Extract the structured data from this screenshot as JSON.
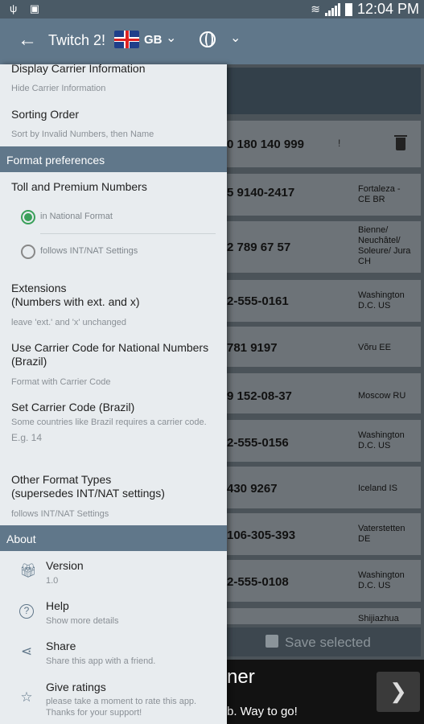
{
  "status": {
    "time": "12:04 PM"
  },
  "appbar": {
    "title": "Twitch 2!",
    "country": "GB"
  },
  "list": {
    "rows": [
      {
        "num": "0 180 140 999",
        "loc": ""
      },
      {
        "num": "5 9140-2417",
        "loc": "Fortaleza - CE BR"
      },
      {
        "num": "2 789 67 57",
        "loc": "Bienne/ Neuchâtel/ Soleure/ Jura CH"
      },
      {
        "num": "2-555-0161",
        "loc": "Washington D.C. US"
      },
      {
        "num": "781 9197",
        "loc": "Võru EE"
      },
      {
        "num": "9 152-08-37",
        "loc": "Moscow RU"
      },
      {
        "num": "2-555-0156",
        "loc": "Washington D.C. US"
      },
      {
        "num": "430 9267",
        "loc": "Iceland IS"
      },
      {
        "num": "106-305-393",
        "loc": "Vaterstetten DE"
      },
      {
        "num": "2-555-0108",
        "loc": "Washington D.C. US"
      },
      {
        "num": "",
        "loc": "Shijiazhua"
      }
    ],
    "save_label": "Save selected"
  },
  "ad": {
    "big": "ner",
    "small": "b. Way to go!"
  },
  "drawer": {
    "display_carrier": {
      "title": "Display Carrier Information",
      "sub": "Hide Carrier Information"
    },
    "sorting": {
      "title": "Sorting Order",
      "sub": "Sort by Invalid Numbers, then Name"
    },
    "format_header": "Format preferences",
    "toll": {
      "title": "Toll and Premium Numbers",
      "opt1": "in National Format",
      "opt2": "follows INT/NAT Settings"
    },
    "extensions": {
      "title1": "Extensions",
      "title2": "(Numbers with ext. and x)",
      "sub": "leave 'ext.' and 'x' unchanged"
    },
    "carrier_code": {
      "title1": "Use Carrier Code for National Numbers",
      "title2": "(Brazil)",
      "sub": "Format with Carrier Code"
    },
    "set_carrier": {
      "title": "Set Carrier Code (Brazil)",
      "sub": "Some countries like Brazil requires a carrier code.",
      "value": "E.g. 14"
    },
    "other_format": {
      "title1": "Other Format Types",
      "title2": "(supersedes INT/NAT settings)",
      "sub": "follows INT/NAT Settings"
    },
    "about_header": "About",
    "version": {
      "title": "Version",
      "sub": "1.0"
    },
    "help": {
      "title": "Help",
      "sub": "Show more details"
    },
    "share": {
      "title": "Share",
      "sub": "Share this app with a friend."
    },
    "rate": {
      "title": "Give ratings",
      "sub1": "please take a moment to rate this app.",
      "sub2": "Thanks for your support!"
    }
  },
  "colors": {
    "accent": "#60778a",
    "radio_on": "#3aa05a"
  }
}
